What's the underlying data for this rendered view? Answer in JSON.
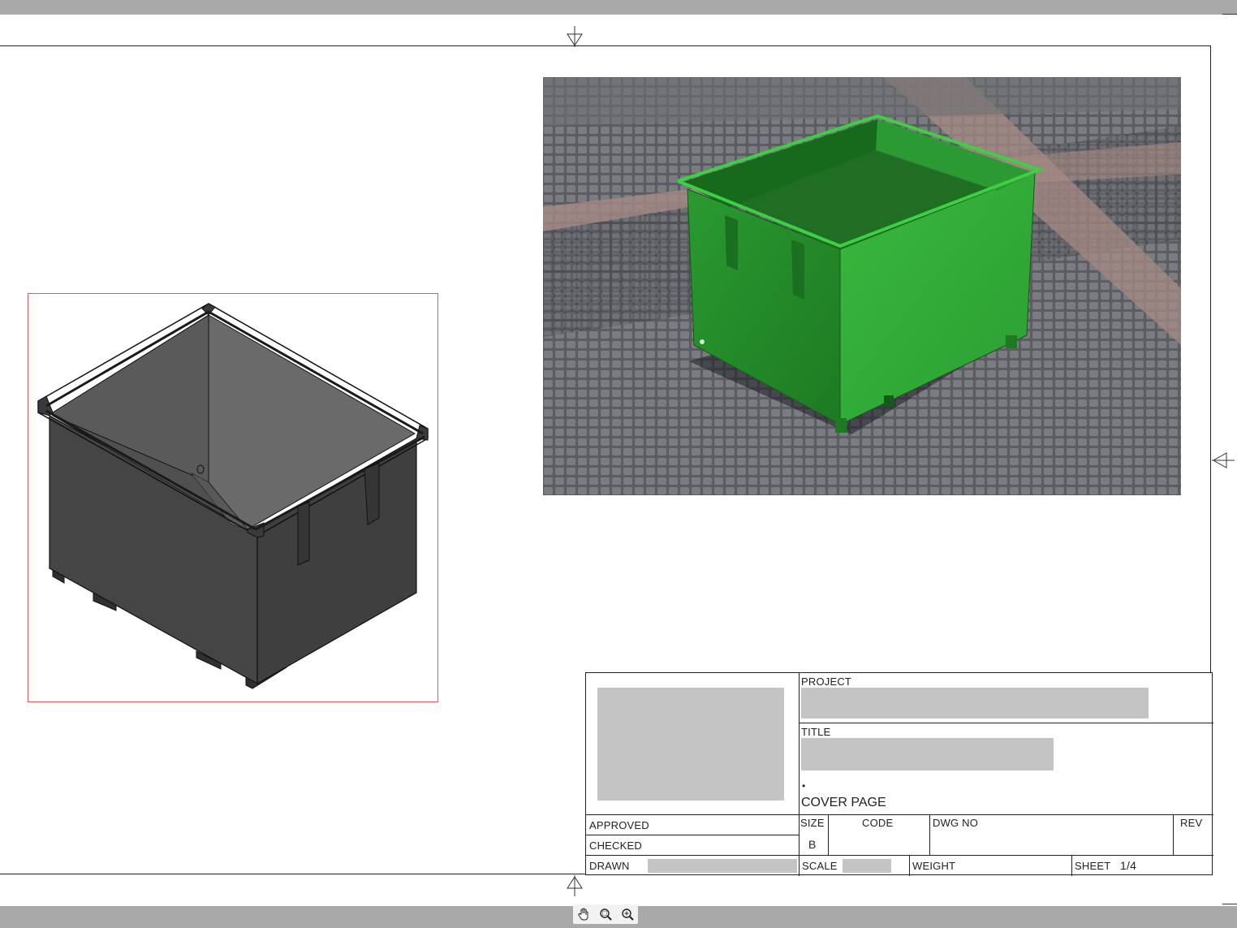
{
  "title_block": {
    "project_label": "PROJECT",
    "title_label": "TITLE",
    "cover_page": "COVER PAGE",
    "cover_bullet": "•",
    "approved_label": "APPROVED",
    "checked_label": "CHECKED",
    "drawn_label": "DRAWN",
    "size_label": "SIZE",
    "size_value": "B",
    "code_label": "CODE",
    "dwg_no_label": "DWG NO",
    "rev_label": "REV",
    "scale_label": "SCALE",
    "weight_label": "WEIGHT",
    "sheet_label": "SHEET",
    "sheet_value": "1/4"
  },
  "views": {
    "iso_view_fill": "#4a4a4a",
    "render_container_color": "#2e9e32",
    "selection_color": "#e05a5a"
  },
  "navigation": {
    "tools": [
      "pan-hand-icon",
      "zoom-window-icon",
      "zoom-icon"
    ]
  }
}
